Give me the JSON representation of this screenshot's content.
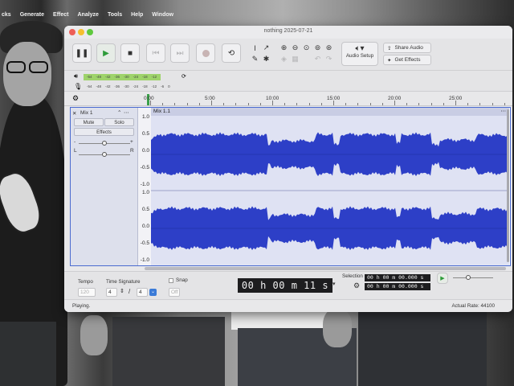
{
  "menubar": {
    "items": [
      "cks",
      "Generate",
      "Effect",
      "Analyze",
      "Tools",
      "Help",
      "Window"
    ]
  },
  "window": {
    "title": "nothing 2025-07-21"
  },
  "toolbar": {
    "audio_setup_label": "Audio Setup",
    "share_audio_label": "Share Audio",
    "get_effects_label": "Get Effects"
  },
  "meter": {
    "ticks": [
      "-54",
      "-48",
      "-42",
      "-36",
      "-30",
      "-24",
      "-18",
      "-12"
    ],
    "record_ticks": [
      "-54",
      "-48",
      "-42",
      "-36",
      "-30",
      "-24",
      "-18",
      "-12",
      "-6",
      "0"
    ],
    "playback_level": 0.86
  },
  "timeline": {
    "labels": [
      "0:00",
      "5:00",
      "10:00",
      "15:00",
      "20:00",
      "25:00"
    ]
  },
  "track": {
    "name": "Mix 1",
    "mute_label": "Mute",
    "solo_label": "Solo",
    "effects_label": "Effects",
    "pan_left": "L",
    "pan_right": "R",
    "clip_name": "Mix 1.1",
    "y_ticks_top": [
      "1.0",
      "0.5",
      "0.0",
      "-0.5",
      "-1.0"
    ],
    "y_ticks_bottom": [
      "1.0",
      "0.5",
      "0.0",
      "-0.5",
      "-1.0"
    ],
    "waveform_color": "#2d3fc7"
  },
  "bottombar": {
    "tempo_label": "Tempo",
    "tempo_value": "120",
    "time_sig_label": "Time Signature",
    "time_sig_num": "4",
    "time_sig_den": "4",
    "snap_label": "Snap",
    "snap_value": "Off",
    "big_time": "00 h 00 m 11 s",
    "selection_label": "Selection",
    "selection_start": "00 h 00 m 00.000 s",
    "selection_end": "00 h 00 m 00.000 s"
  },
  "status": {
    "left": "Playing.",
    "right": "Actual Rate: 44100"
  },
  "colors": {
    "accent_green": "#2e9c3a",
    "selection_blue": "#3b7bd8"
  }
}
